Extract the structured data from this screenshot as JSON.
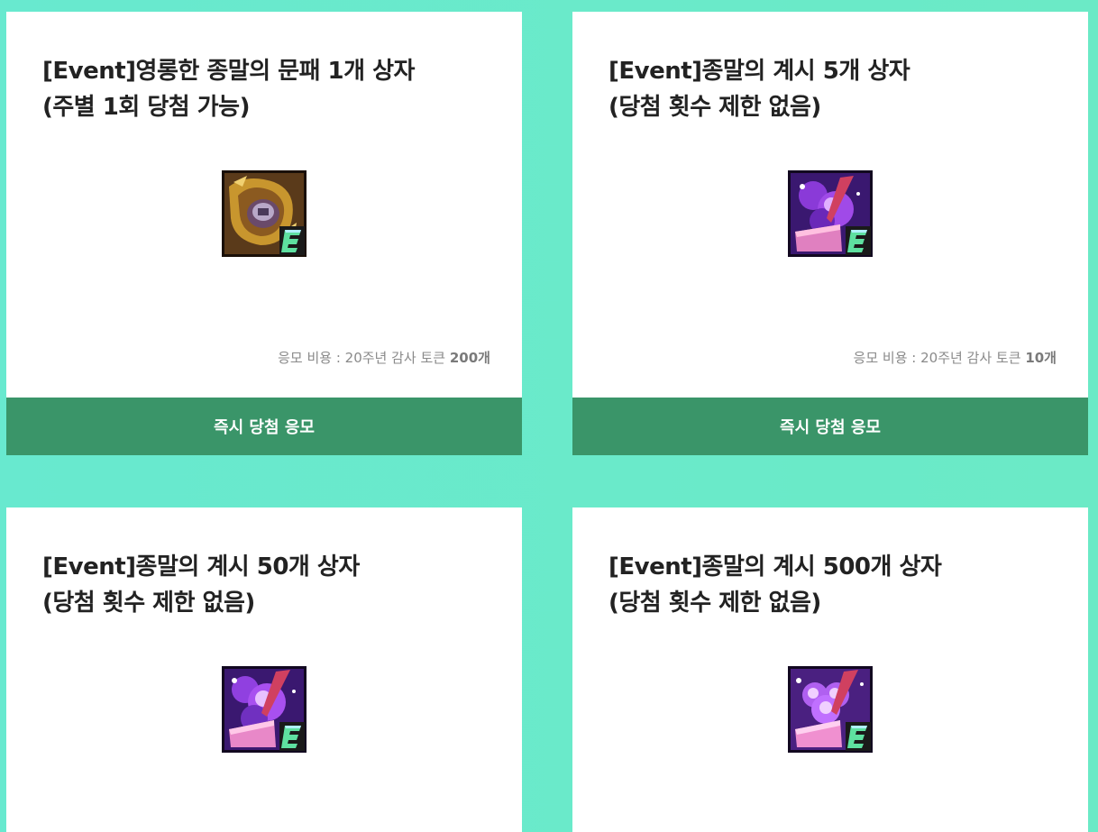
{
  "cards": [
    {
      "title_line1": "[Event]영롱한 종말의 문패 1개 상자",
      "title_line2": "(주별 1회 당첨 가능)",
      "icon": "golden-doorplate-box-icon",
      "cost_label": "응모 비용 : 20주년 감사 토큰",
      "cost_amount": "200개",
      "button_label": "즉시 당첨 응모"
    },
    {
      "title_line1": "[Event]종말의 계시 5개 상자",
      "title_line2": "(당첨 횟수 제한 없음)",
      "icon": "purple-revelation-box-icon",
      "cost_label": "응모 비용 : 20주년 감사 토큰",
      "cost_amount": "10개",
      "button_label": "즉시 당첨 응모"
    },
    {
      "title_line1": "[Event]종말의 계시 50개 상자",
      "title_line2": "(당첨 횟수 제한 없음)",
      "icon": "purple-revelation-box-icon"
    },
    {
      "title_line1": "[Event]종말의 계시 500개 상자",
      "title_line2": "(당첨 횟수 제한 없음)",
      "icon": "purple-revelation-box-icon"
    }
  ],
  "colors": {
    "background": "#68e9cf",
    "card": "#ffffff",
    "button": "#3a9569",
    "title": "#222222",
    "cost_text": "#8a8a8a"
  }
}
